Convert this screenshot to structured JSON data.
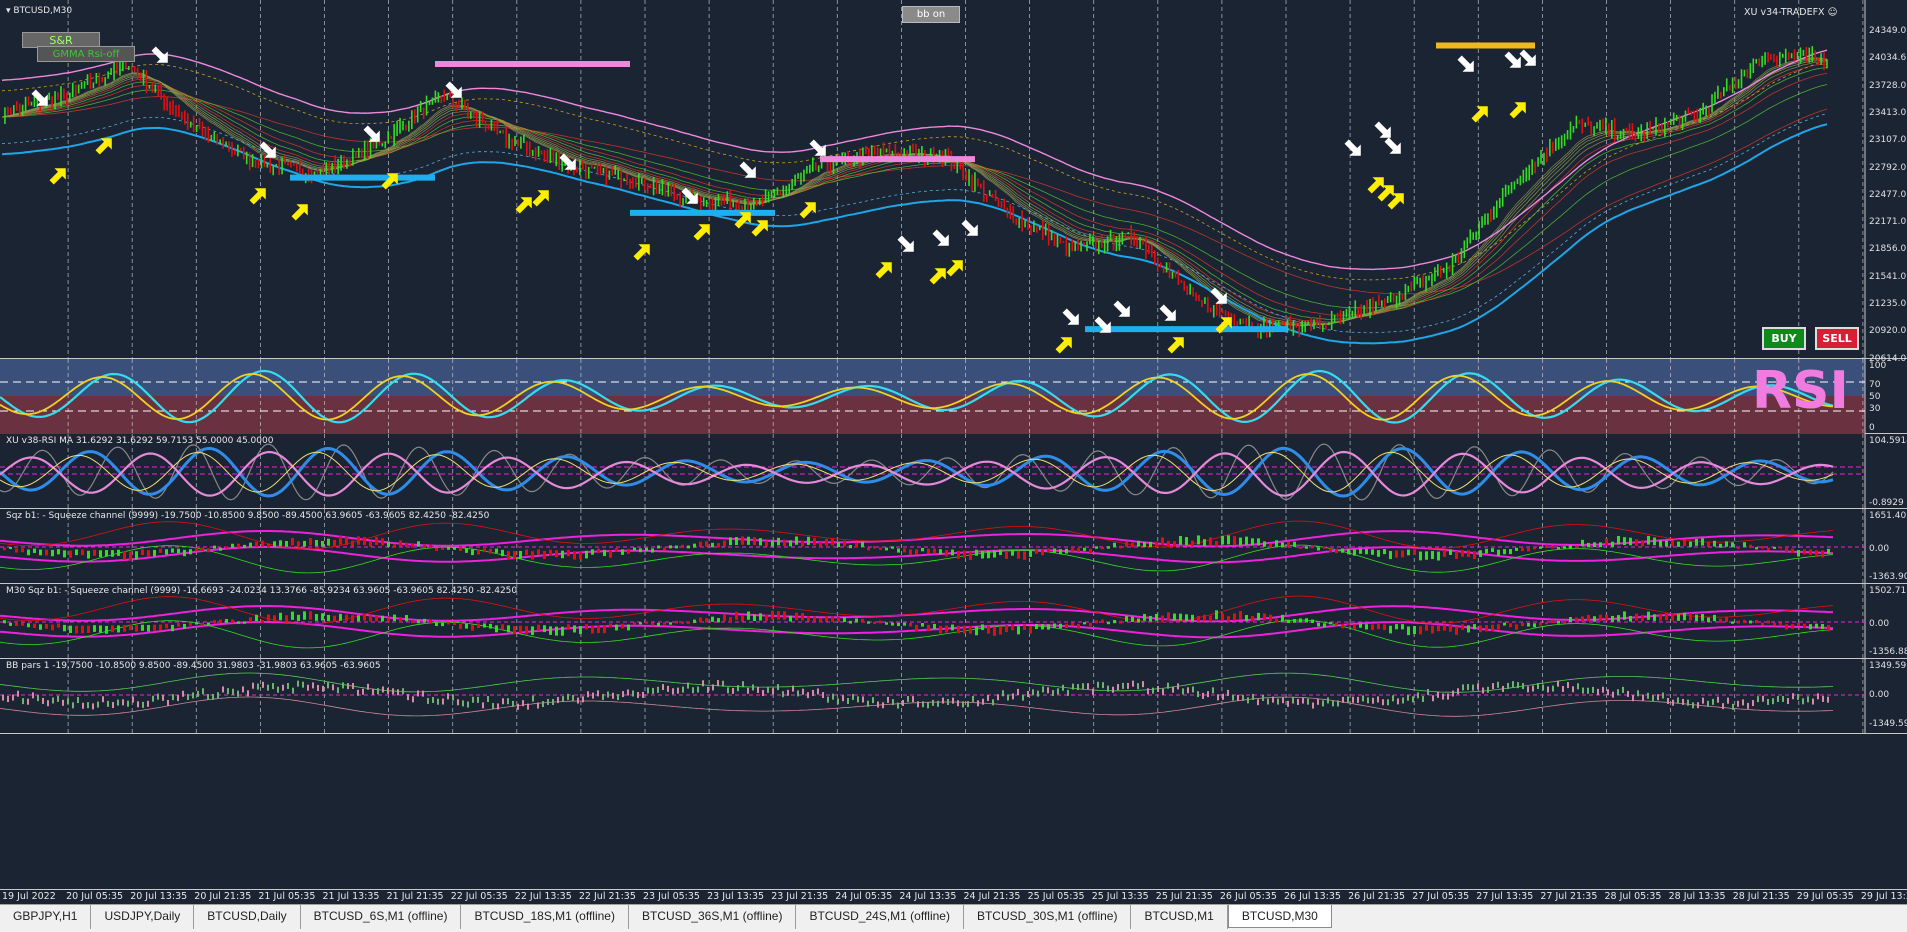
{
  "chart_window": {
    "title": "BTCUSD,M30",
    "bb_button": "bb on",
    "expert_label": "XU v34-TRADEFX",
    "sr_button": "S&R",
    "gmma_button": "GMMA Rsi-off",
    "buy_button": "BUY",
    "sell_button": "SELL",
    "watermark": "RSI",
    "price_labels": [
      "24349.0",
      "24034.6",
      "23728.0",
      "23413.0",
      "23107.0",
      "22792.0",
      "22477.0",
      "22171.0",
      "21856.0",
      "21541.0",
      "21235.0",
      "20920.0",
      "20614.0"
    ]
  },
  "rsi_pane": {
    "levels": [
      "100",
      "70",
      "50",
      "30",
      "0"
    ]
  },
  "rsi_ma_pane": {
    "label": "XU v38-RSI MA 31.6292 31.6292 59.7153 55.0000 45.0000",
    "scale": [
      "104.5914",
      "-0.8929"
    ]
  },
  "sqz_pane_1": {
    "label": "Sqz b1: - Squeeze channel (9999) -19.7500 -10.8500 9.8500 -89.4500 63.9605 -63.9605 82.4250 -82.4250",
    "scale": [
      "1651.40",
      "0.00",
      "-1363.90"
    ]
  },
  "sqz_pane_2": {
    "label": "M30 Sqz b1: - Squeeze channel (9999) -16.6693 -24.0234 13.3766 -85.9234 63.9605 -63.9605 82.4250 -82.4250",
    "scale": [
      "1502.71",
      "0.00",
      "-1356.88"
    ]
  },
  "bb_pane": {
    "label": "BB pars 1 -19.7500 -10.8500 9.8500 -89.4500 31.9803 -31.9803 63.9605 -63.9605",
    "scale": [
      "1349.59",
      "0.00",
      "-1349.59"
    ]
  },
  "time_axis": [
    "19 Jul 2022",
    "20 Jul 05:35",
    "20 Jul 13:35",
    "20 Jul 21:35",
    "21 Jul 05:35",
    "21 Jul 13:35",
    "21 Jul 21:35",
    "22 Jul 05:35",
    "22 Jul 13:35",
    "22 Jul 21:35",
    "23 Jul 05:35",
    "23 Jul 13:35",
    "23 Jul 21:35",
    "24 Jul 05:35",
    "24 Jul 13:35",
    "24 Jul 21:35",
    "25 Jul 05:35",
    "25 Jul 13:35",
    "25 Jul 21:35",
    "26 Jul 05:35",
    "26 Jul 13:35",
    "26 Jul 21:35",
    "27 Jul 05:35",
    "27 Jul 13:35",
    "27 Jul 21:35",
    "28 Jul 05:35",
    "28 Jul 13:35",
    "28 Jul 21:35",
    "29 Jul 05:35",
    "29 Jul 13:35"
  ],
  "tabs": [
    {
      "label": "GBPJPY,H1",
      "active": false
    },
    {
      "label": "USDJPY,Daily",
      "active": false
    },
    {
      "label": "BTCUSD,Daily",
      "active": false
    },
    {
      "label": "BTCUSD_6S,M1 (offline)",
      "active": false
    },
    {
      "label": "BTCUSD_18S,M1 (offline)",
      "active": false
    },
    {
      "label": "BTCUSD_36S,M1 (offline)",
      "active": false
    },
    {
      "label": "BTCUSD_24S,M1 (offline)",
      "active": false
    },
    {
      "label": "BTCUSD_30S,M1 (offline)",
      "active": false
    },
    {
      "label": "BTCUSD,M1",
      "active": false
    },
    {
      "label": "BTCUSD,M30",
      "active": true
    }
  ],
  "colors": {
    "background": "#1b2433",
    "bull": "#33dd22",
    "bear": "#e01010",
    "rsi_cyan": "#33ddee",
    "rsi_yellow": "#f0d020",
    "pink": "#ee88dd",
    "blue_line": "#1ea6e8",
    "arrow_yellow": "#ffee00",
    "arrow_white": "#ffffff",
    "magenta": "#ee22dd"
  },
  "chart_data": [
    {
      "type": "line",
      "title": "BTCUSD,M30",
      "x": [
        "19 Jul 2022",
        "20 Jul 05:35",
        "20 Jul 13:35",
        "20 Jul 21:35",
        "21 Jul 05:35",
        "21 Jul 13:35",
        "21 Jul 21:35",
        "22 Jul 05:35",
        "22 Jul 13:35",
        "22 Jul 21:35",
        "23 Jul 05:35",
        "23 Jul 13:35",
        "23 Jul 21:35",
        "24 Jul 05:35",
        "24 Jul 13:35",
        "24 Jul 21:35",
        "25 Jul 05:35",
        "25 Jul 13:35",
        "25 Jul 21:35",
        "26 Jul 05:35",
        "26 Jul 13:35",
        "26 Jul 21:35",
        "27 Jul 05:35",
        "27 Jul 13:35",
        "27 Jul 21:35",
        "28 Jul 05:35",
        "28 Jul 13:35",
        "28 Jul 21:35",
        "29 Jul 05:35",
        "29 Jul 13:35"
      ],
      "series": [
        {
          "values": [
            23300,
            23480,
            23850,
            23150,
            22750,
            22600,
            22950,
            23500,
            23000,
            22700,
            22550,
            22300,
            22250,
            22700,
            22850,
            22800,
            22150,
            21750,
            21900,
            21150,
            20850,
            20900,
            21150,
            21550,
            22500,
            23150,
            23050,
            23300,
            23950,
            23900
          ]
        }
      ],
      "ylim": [
        20614,
        24349
      ],
      "grid": true
    }
  ]
}
